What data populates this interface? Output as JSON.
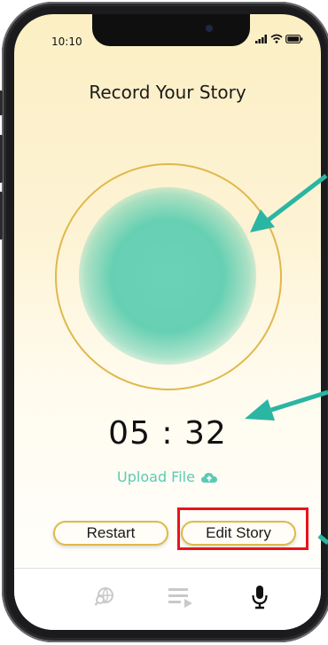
{
  "status_bar": {
    "time": "10:10"
  },
  "page": {
    "title": "Record Your Story"
  },
  "recorder": {
    "timer": "05 : 32"
  },
  "upload": {
    "label": "Upload File"
  },
  "actions": {
    "restart_label": "Restart",
    "edit_label": "Edit Story"
  },
  "tabs": [
    {
      "icon": "globe-search-icon",
      "active": false
    },
    {
      "icon": "playlist-icon",
      "active": false
    },
    {
      "icon": "microphone-icon",
      "active": true
    }
  ],
  "colors": {
    "accent_teal": "#5ccab2",
    "ring_gold": "#e0b84b",
    "highlight_red": "#e8141b",
    "annotation_arrow": "#2bb5a3"
  }
}
